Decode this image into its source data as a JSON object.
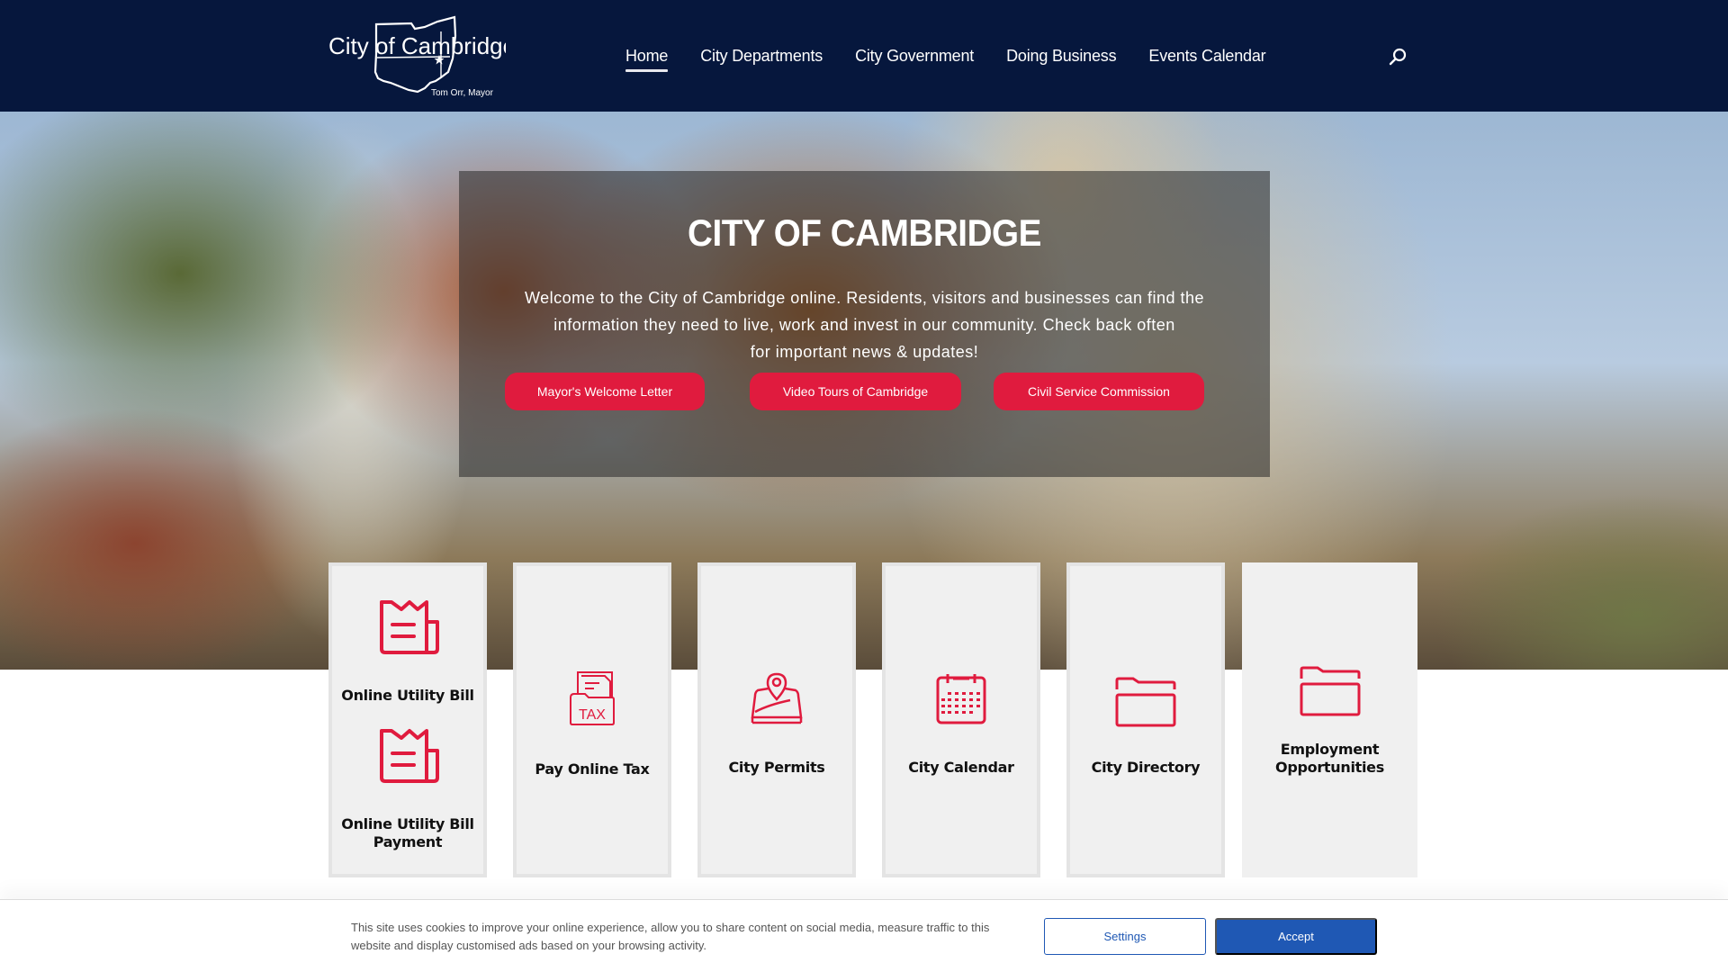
{
  "header": {
    "logo": {
      "title": "City of Cambridge",
      "subtitle": "Tom Orr, Mayor"
    },
    "nav": [
      {
        "label": "Home",
        "active": true
      },
      {
        "label": "City Departments",
        "active": false
      },
      {
        "label": "City Government",
        "active": false
      },
      {
        "label": "Doing Business",
        "active": false
      },
      {
        "label": "Events Calendar",
        "active": false
      }
    ],
    "search_icon": "search-icon"
  },
  "hero": {
    "title": "CITY OF CAMBRIDGE",
    "text_lines": [
      "Welcome to the City of Cambridge online. Residents, visitors and businesses can find the",
      "information they need to live, work and invest in our community. Check back often",
      "for important news & updates!"
    ],
    "buttons": [
      {
        "label": "Mayor's Welcome Letter"
      },
      {
        "label": "Video Tours of Cambridge"
      },
      {
        "label": "Civil Service Commission"
      }
    ]
  },
  "cards": [
    {
      "label": "Online Utility Bill",
      "icon": "newspaper-icon"
    },
    {
      "label": "Online Utility Bill Payment",
      "icon": "newspaper-icon"
    },
    {
      "label": "Pay Online Tax",
      "icon": "tax-folder-icon"
    },
    {
      "label": "City Permits",
      "icon": "map-pin-icon"
    },
    {
      "label": "City Calendar",
      "icon": "calendar-icon"
    },
    {
      "label": "City Directory",
      "icon": "folder-icon"
    },
    {
      "label": "Employment Opportunities",
      "icon": "folder-icon"
    }
  ],
  "cookie_banner": {
    "text": "This site uses cookies to improve your online experience, allow you to share content on social media, measure traffic to this website and display customised ads based on your browsing activity.",
    "settings_label": "Settings",
    "accept_label": "Accept"
  },
  "colors": {
    "header_bg": "#06173d",
    "accent_red": "#e01b3e",
    "card_bg": "#f0f0f0",
    "cookie_blue": "#1f58b4"
  }
}
